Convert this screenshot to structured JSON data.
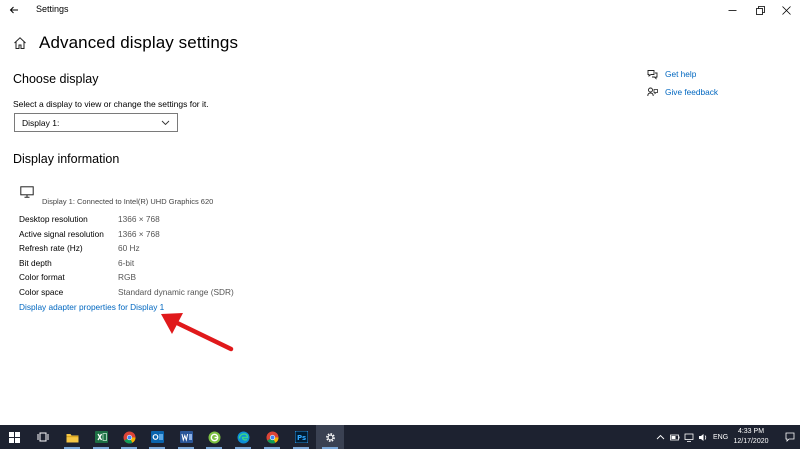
{
  "window": {
    "title": "Settings",
    "controls": [
      "minimize",
      "maximize",
      "close"
    ]
  },
  "header": {
    "title": "Advanced display settings"
  },
  "choose_display": {
    "title": "Choose display",
    "description": "Select a display to view or change the settings for it.",
    "selected": "Display 1:"
  },
  "display_info": {
    "title": "Display information",
    "connected": "Display 1: Connected to Intel(R) UHD Graphics 620",
    "rows": [
      {
        "label": "Desktop resolution",
        "value": "1366 × 768"
      },
      {
        "label": "Active signal resolution",
        "value": "1366 × 768"
      },
      {
        "label": "Refresh rate (Hz)",
        "value": "60 Hz"
      },
      {
        "label": "Bit depth",
        "value": "6-bit"
      },
      {
        "label": "Color format",
        "value": "RGB"
      },
      {
        "label": "Color space",
        "value": "Standard dynamic range (SDR)"
      }
    ],
    "adapter_link": "Display adapter properties for Display 1"
  },
  "help": {
    "get_help": "Get help",
    "give_feedback": "Give feedback"
  },
  "annotation": {
    "arrow_color": "#e0191b"
  },
  "taskbar": {
    "apps": [
      "start-icon",
      "task-view-icon",
      "file-explorer-icon",
      "excel-icon",
      "chrome-icon",
      "outlook-icon",
      "word-icon",
      "greenshot-icon",
      "edge-icon",
      "chrome-icon",
      "photoshop-icon",
      "settings-icon"
    ],
    "language": "ENG",
    "time": "4:33 PM",
    "date": "12/17/2020"
  },
  "colors": {
    "accent": "#0067c0",
    "taskbar": "#1d2230"
  }
}
